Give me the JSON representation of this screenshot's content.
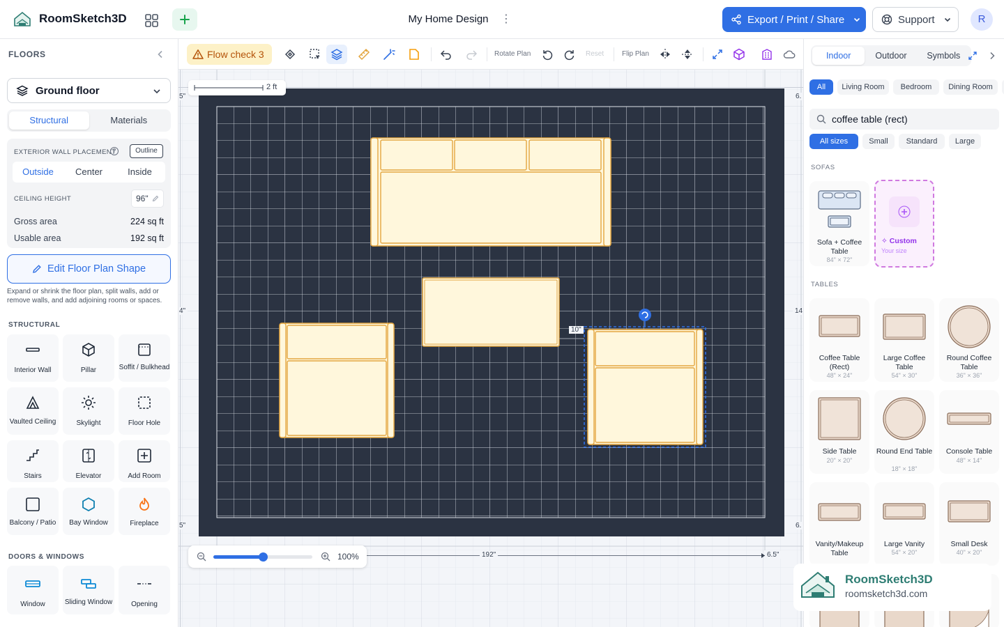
{
  "app": {
    "name": "RoomSketch3D",
    "doc_title": "My Home Design"
  },
  "header": {
    "export_label": "Export / Print / Share",
    "support_label": "Support",
    "avatar_initial": "R"
  },
  "left": {
    "floors_heading": "FLOORS",
    "floor_selected": "Ground floor",
    "tabs": [
      "Structural",
      "Materials"
    ],
    "exterior_wall_label": "EXTERIOR WALL PLACEMENT",
    "outline_badge": "Outline",
    "placement_options": [
      "Outside",
      "Center",
      "Inside"
    ],
    "ceiling_label": "CEILING HEIGHT",
    "ceiling_value": "96\"",
    "gross_label": "Gross area",
    "gross_value": "224 sq ft",
    "usable_label": "Usable area",
    "usable_value": "192 sq ft",
    "edit_shape_label": "Edit Floor Plan Shape",
    "edit_shape_desc": "Expand or shrink the floor plan, split walls, add or remove walls, and add adjoining rooms or spaces.",
    "structural_heading": "STRUCTURAL",
    "structural_tools": [
      {
        "label": "Interior Wall",
        "icon": "interior-wall-icon"
      },
      {
        "label": "Pillar",
        "icon": "pillar-icon"
      },
      {
        "label": "Soffit / Bulkhead",
        "icon": "soffit-icon"
      },
      {
        "label": "Vaulted Ceiling",
        "icon": "vaulted-ceiling-icon"
      },
      {
        "label": "Skylight",
        "icon": "skylight-icon"
      },
      {
        "label": "Floor Hole",
        "icon": "floor-hole-icon"
      },
      {
        "label": "Stairs",
        "icon": "stairs-icon"
      },
      {
        "label": "Elevator",
        "icon": "elevator-icon"
      },
      {
        "label": "Add Room",
        "icon": "add-room-icon"
      },
      {
        "label": "Balcony / Patio",
        "icon": "balcony-icon"
      },
      {
        "label": "Bay Window",
        "icon": "bay-window-icon"
      },
      {
        "label": "Fireplace",
        "icon": "fireplace-icon"
      }
    ],
    "doors_heading": "DOORS & WINDOWS",
    "door_tools": [
      {
        "label": "Window",
        "icon": "window-icon"
      },
      {
        "label": "Sliding Window",
        "icon": "sliding-window-icon"
      },
      {
        "label": "Opening",
        "icon": "opening-icon"
      }
    ]
  },
  "toolbar": {
    "flow_check_label": "Flow check 3",
    "rotate_plan_label": "Rotate Plan",
    "reset_label": "Reset",
    "flip_plan_label": "Flip Plan"
  },
  "canvas": {
    "scale_label": "2 ft",
    "zoom_label": "100%",
    "zoom_level": 0.5,
    "dim_bottom": "192\"",
    "dim_bottom_right": "6.5\"",
    "dim_gap": "10\"",
    "dim_left_mid": "4\"",
    "dim_right_mid": "14",
    "dim_top_left": "5\"",
    "dim_top_right": "6.",
    "dim_bottom_left": "5\"",
    "dim_bottom_right_side": "6."
  },
  "right": {
    "tabs": [
      "Indoor",
      "Outdoor",
      "Symbols"
    ],
    "room_chips": [
      "All",
      "Living Room",
      "Bedroom",
      "Dining Room"
    ],
    "search_value": "coffee table (rect)",
    "size_chips": [
      "All sizes",
      "Small",
      "Standard",
      "Large"
    ],
    "sofas_heading": "SOFAS",
    "sofa_card": {
      "name": "Sofa + Coffee Table",
      "size": "84\" × 72\""
    },
    "custom_card": {
      "name": "Custom",
      "size": "Your size"
    },
    "tables_heading": "TABLES",
    "tables": [
      {
        "name": "Coffee Table (Rect)",
        "size": "48\" × 24\""
      },
      {
        "name": "Large Coffee Table",
        "size": "54\" × 30\""
      },
      {
        "name": "Round Coffee Table",
        "size": "36\" × 36\""
      },
      {
        "name": "Side Table",
        "size": "20\" × 20\""
      },
      {
        "name": "Round End Table",
        "size": "18\" × 18\""
      },
      {
        "name": "Console Table",
        "size": "48\" × 14\""
      },
      {
        "name": "Vanity/Makeup Table",
        "size": ""
      },
      {
        "name": "Large Vanity",
        "size": "54\" × 20\""
      },
      {
        "name": "Small Desk",
        "size": "40\" × 20\""
      }
    ],
    "watermark_name": "RoomSketch3D",
    "watermark_url": "roomsketch3d.com"
  },
  "colors": {
    "accent": "#2f6fe4",
    "wall": "#2b3342",
    "furniture_fill": "#fff7dc",
    "furniture_stroke": "#e3a640",
    "flow_bg": "#fdf1c7"
  }
}
